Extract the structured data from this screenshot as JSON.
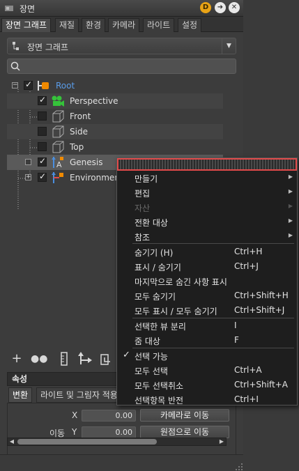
{
  "window": {
    "title": "장면"
  },
  "tabs": [
    {
      "label": "장면 그래프",
      "active": true
    },
    {
      "label": "재질"
    },
    {
      "label": "환경"
    },
    {
      "label": "카메라"
    },
    {
      "label": "라이트"
    },
    {
      "label": "설정"
    }
  ],
  "scene_selector": {
    "value": "장면 그래프"
  },
  "search": {
    "placeholder": ""
  },
  "tree": [
    {
      "label": "Root",
      "checked": true,
      "icon": "root-icon"
    },
    {
      "label": "Perspective",
      "checked": true,
      "icon": "perspective-icon"
    },
    {
      "label": "Front",
      "checked": false,
      "icon": "camera-cube-icon"
    },
    {
      "label": "Side",
      "checked": false,
      "icon": "camera-cube-icon"
    },
    {
      "label": "Top",
      "checked": false,
      "icon": "camera-cube-icon"
    },
    {
      "label": "Genesis",
      "checked": true,
      "icon": "figure-icon"
    },
    {
      "label": "Environment",
      "checked": true,
      "icon": "environment-icon"
    }
  ],
  "properties": {
    "header": "속성",
    "tabs": [
      {
        "label": "변환",
        "active": true
      },
      {
        "label": "라이트 및 그림자 적용"
      }
    ],
    "x_label": "X",
    "x_value": "0.00",
    "move_label": "이동",
    "y_label": "Y",
    "y_value": "0.00",
    "move_to_camera": "카메라로 이동",
    "move_to_origin": "원점으로 이동"
  },
  "context_menu": {
    "items": [
      {
        "label": "만들기",
        "submenu": true
      },
      {
        "label": "편집",
        "submenu": true
      },
      {
        "label": "자산",
        "submenu": true,
        "disabled": true
      },
      {
        "label": "전환 대상",
        "submenu": true
      },
      {
        "label": "참조",
        "submenu": true
      },
      {
        "label": "숨기기 (H)",
        "shortcut": "Ctrl+H"
      },
      {
        "label": "표시 / 숨기기",
        "shortcut": "Ctrl+J"
      },
      {
        "label": "마지막으로 숨긴 사항 표시",
        "shortcut": ""
      },
      {
        "label": "모두 숨기기",
        "shortcut": "Ctrl+Shift+H"
      },
      {
        "label": "모두 표시 / 모두 숨기기",
        "shortcut": "Ctrl+Shift+J"
      },
      {
        "label": "선택한 뷰 분리",
        "shortcut": "I"
      },
      {
        "label": "줌 대상",
        "shortcut": "F"
      },
      {
        "label": "선택 가능",
        "shortcut": "",
        "checked": true
      },
      {
        "label": "모두 선택",
        "shortcut": "Ctrl+A"
      },
      {
        "label": "모두 선택취소",
        "shortcut": "Ctrl+Shift+A"
      },
      {
        "label": "선택항목 반전",
        "shortcut": "Ctrl+I"
      }
    ]
  }
}
